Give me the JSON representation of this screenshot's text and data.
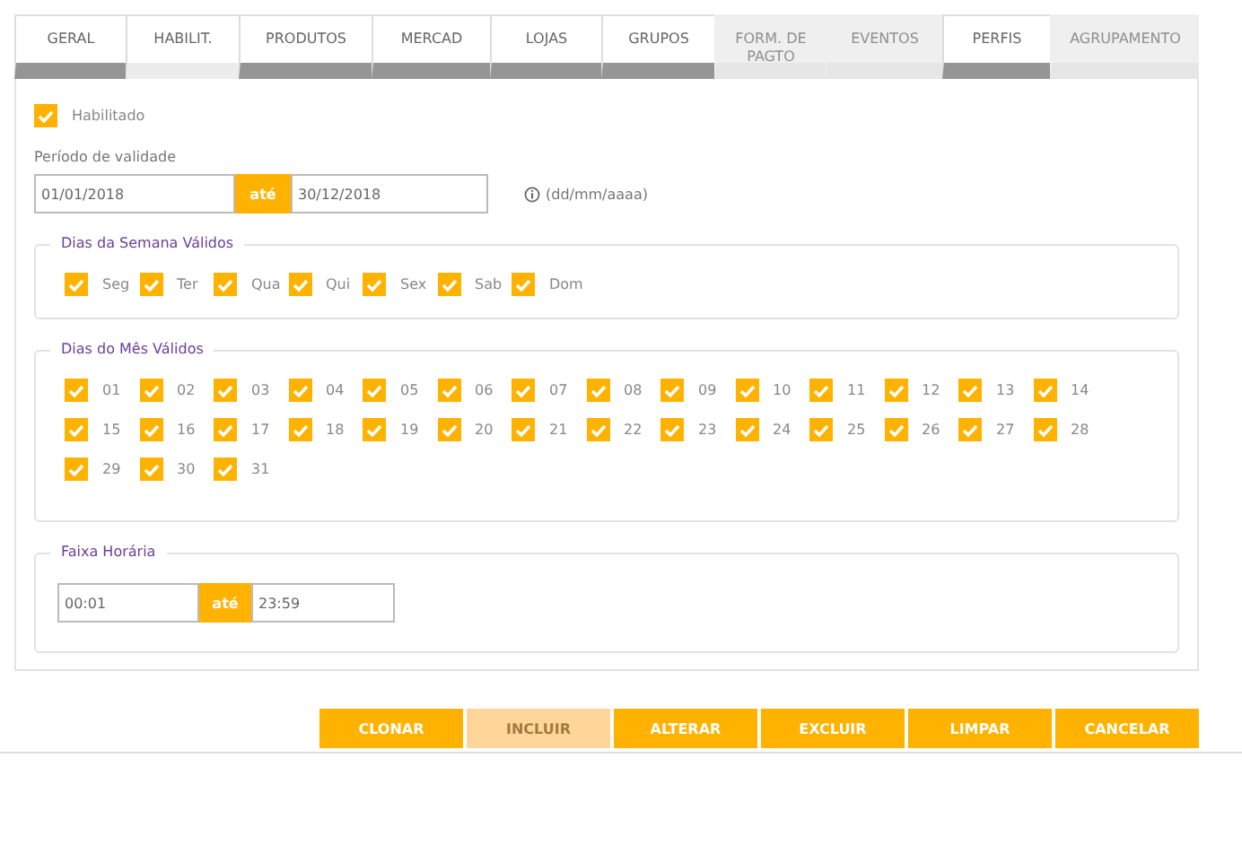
{
  "tabs": [
    {
      "label": "GERAL",
      "selected": false,
      "disabled": false
    },
    {
      "label": "HABILIT.",
      "selected": true,
      "disabled": false
    },
    {
      "label": "PRODUTOS",
      "selected": false,
      "disabled": false
    },
    {
      "label": "MERCAD",
      "selected": false,
      "disabled": false
    },
    {
      "label": "LOJAS",
      "selected": false,
      "disabled": false
    },
    {
      "label": "GRUPOS",
      "selected": false,
      "disabled": false
    },
    {
      "label": "FORM. DE PAGTO",
      "selected": false,
      "disabled": true
    },
    {
      "label": "EVENTOS",
      "selected": false,
      "disabled": true
    },
    {
      "label": "PERFIS",
      "selected": false,
      "disabled": false
    },
    {
      "label": "AGRUPAMENTO",
      "selected": false,
      "disabled": true
    }
  ],
  "enabled": {
    "label": "Habilitado",
    "checked": true
  },
  "validity": {
    "label": "Período de validade",
    "from": "01/01/2018",
    "separator": "até",
    "to": "30/12/2018",
    "hint": "(dd/mm/aaaa)"
  },
  "weekdays": {
    "legend": "Dias da Semana Válidos",
    "items": [
      {
        "label": "Seg",
        "checked": true
      },
      {
        "label": "Ter",
        "checked": true
      },
      {
        "label": "Qua",
        "checked": true
      },
      {
        "label": "Qui",
        "checked": true
      },
      {
        "label": "Sex",
        "checked": true
      },
      {
        "label": "Sab",
        "checked": true
      },
      {
        "label": "Dom",
        "checked": true
      }
    ]
  },
  "month_days": {
    "legend": "Dias do Mês Válidos",
    "items": [
      {
        "label": "01",
        "checked": true
      },
      {
        "label": "02",
        "checked": true
      },
      {
        "label": "03",
        "checked": true
      },
      {
        "label": "04",
        "checked": true
      },
      {
        "label": "05",
        "checked": true
      },
      {
        "label": "06",
        "checked": true
      },
      {
        "label": "07",
        "checked": true
      },
      {
        "label": "08",
        "checked": true
      },
      {
        "label": "09",
        "checked": true
      },
      {
        "label": "10",
        "checked": true
      },
      {
        "label": "11",
        "checked": true
      },
      {
        "label": "12",
        "checked": true
      },
      {
        "label": "13",
        "checked": true
      },
      {
        "label": "14",
        "checked": true
      },
      {
        "label": "15",
        "checked": true
      },
      {
        "label": "16",
        "checked": true
      },
      {
        "label": "17",
        "checked": true
      },
      {
        "label": "18",
        "checked": true
      },
      {
        "label": "19",
        "checked": true
      },
      {
        "label": "20",
        "checked": true
      },
      {
        "label": "21",
        "checked": true
      },
      {
        "label": "22",
        "checked": true
      },
      {
        "label": "23",
        "checked": true
      },
      {
        "label": "24",
        "checked": true
      },
      {
        "label": "25",
        "checked": true
      },
      {
        "label": "26",
        "checked": true
      },
      {
        "label": "27",
        "checked": true
      },
      {
        "label": "28",
        "checked": true
      },
      {
        "label": "29",
        "checked": true
      },
      {
        "label": "30",
        "checked": true
      },
      {
        "label": "31",
        "checked": true
      }
    ]
  },
  "time_range": {
    "legend": "Faixa Horária",
    "from": "00:01",
    "separator": "até",
    "to": "23:59"
  },
  "buttons": [
    {
      "label": "CLONAR",
      "disabled": false
    },
    {
      "label": "INCLUIR",
      "disabled": true
    },
    {
      "label": "ALTERAR",
      "disabled": false
    },
    {
      "label": "EXCLUIR",
      "disabled": false
    },
    {
      "label": "LIMPAR",
      "disabled": false
    },
    {
      "label": "CANCELAR",
      "disabled": false
    }
  ]
}
